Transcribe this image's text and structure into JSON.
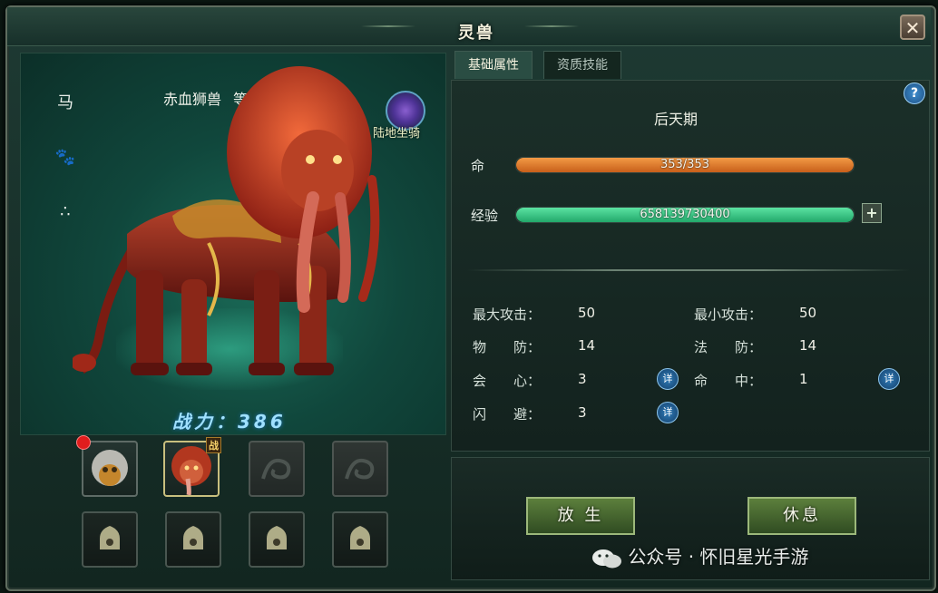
{
  "window": {
    "title": "灵兽"
  },
  "side_icons": [
    {
      "name": "horse-icon",
      "glyph": "马"
    },
    {
      "name": "paw-icon",
      "glyph": "🐾"
    },
    {
      "name": "pet-type-icon",
      "glyph": "∴"
    }
  ],
  "pet": {
    "name": "赤血狮兽",
    "level_text": "等级 20",
    "badge_text": "陆地坐骑",
    "power_text": "战力：386"
  },
  "slots": {
    "war_tag": "战"
  },
  "tabs": [
    "基础属性",
    "资质技能"
  ],
  "stats": {
    "stage": "后天期",
    "hp_label": "命",
    "hp_text": "353/353",
    "hp_fraction": 1.0,
    "exp_label": "经验",
    "exp_text": "65813973040​0",
    "exp_fraction": 1.0,
    "plus_label": "+",
    "help_label": "?",
    "attributes": [
      {
        "name": "最大攻击：",
        "value": "50"
      },
      {
        "name": "最小攻击：",
        "value": "50"
      },
      {
        "name": "物　　防：",
        "value": "14"
      },
      {
        "name": "法　　防：",
        "value": "14"
      },
      {
        "name": "会　　心：",
        "value": "3"
      },
      {
        "name": "命　　中：",
        "value": "1"
      },
      {
        "name": "闪　　避：",
        "value": "3"
      }
    ],
    "detail_labels": [
      "详",
      "详",
      "详"
    ]
  },
  "actions": {
    "release": "放 生",
    "rest": "休息"
  },
  "watermark": "公众号 · 怀旧星光手游",
  "colors": {
    "hp_bar": "#e07a2a",
    "exp_bar": "#3cc987",
    "accent_gold": "#c9bf7e"
  }
}
